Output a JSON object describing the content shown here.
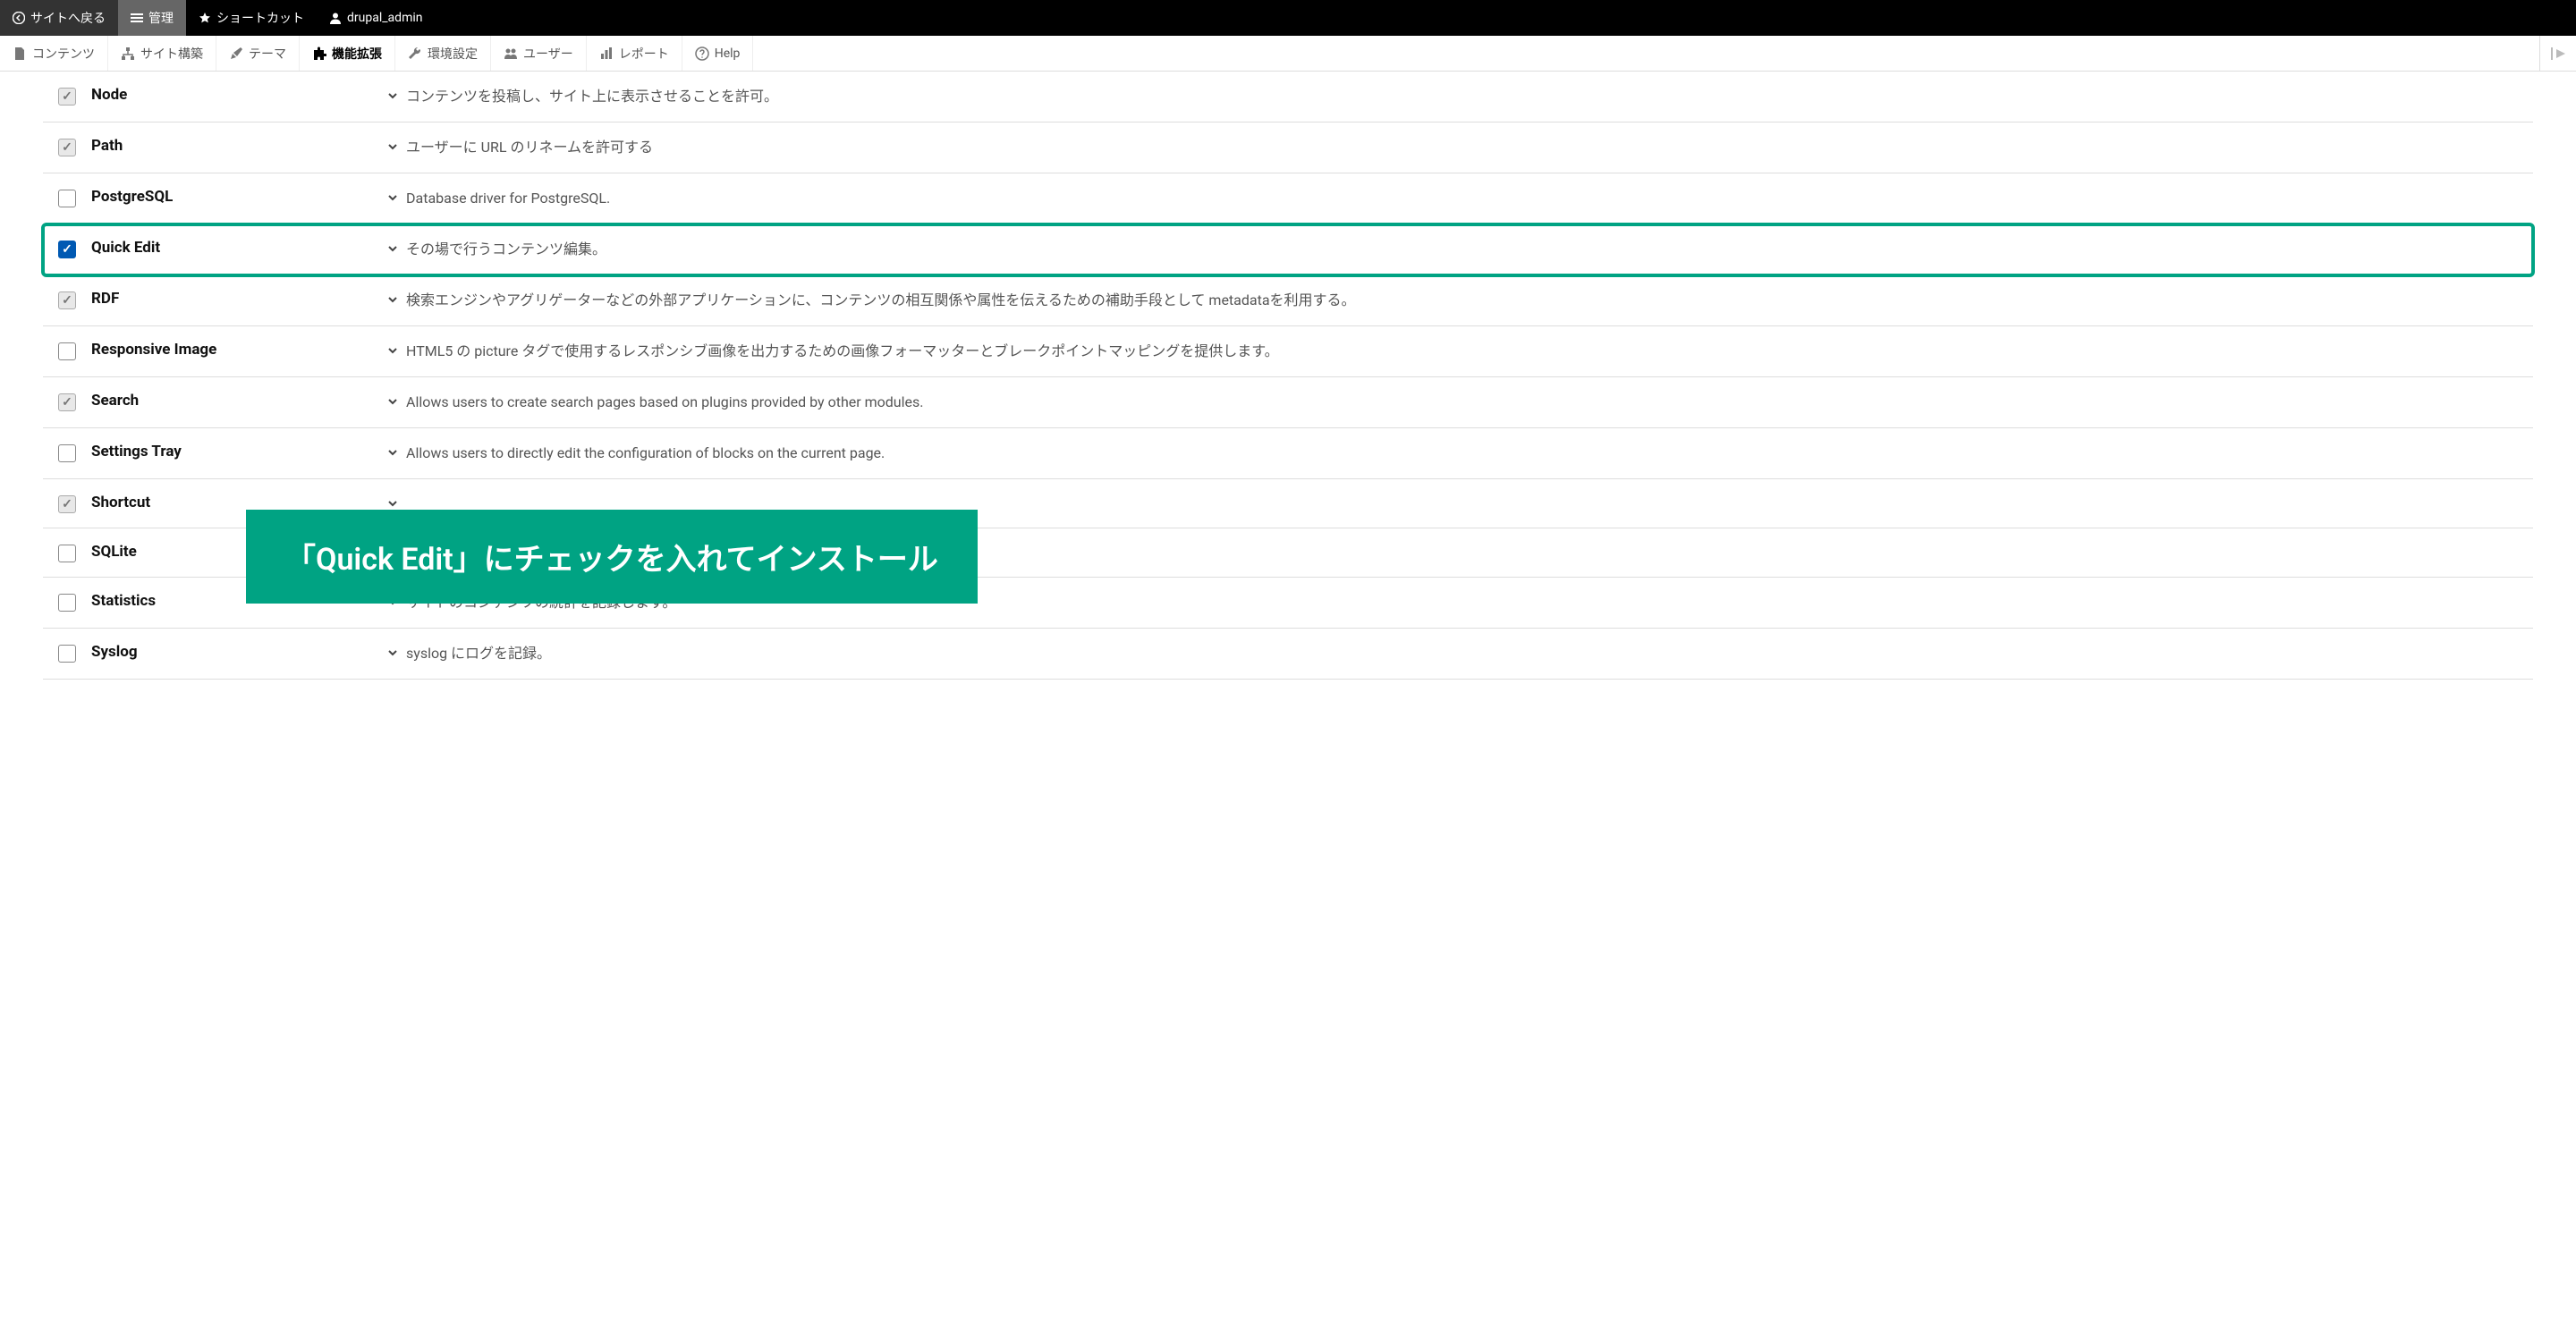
{
  "topbar": {
    "back": "サイトへ戻る",
    "admin": "管理",
    "shortcuts": "ショートカット",
    "user": "drupal_admin"
  },
  "secondbar": {
    "content": "コンテンツ",
    "structure": "サイト構築",
    "appearance": "テーマ",
    "extend": "機能拡張",
    "configuration": "環境設定",
    "people": "ユーザー",
    "reports": "レポート",
    "help": "Help"
  },
  "modules": [
    {
      "name": "Node",
      "desc": "コンテンツを投稿し、サイト上に表示させることを許可。",
      "checked": true,
      "disabled": true,
      "highlight": false
    },
    {
      "name": "Path",
      "desc": "ユーザーに URL のリネームを許可する",
      "checked": true,
      "disabled": true,
      "highlight": false
    },
    {
      "name": "PostgreSQL",
      "desc": "Database driver for PostgreSQL.",
      "checked": false,
      "disabled": false,
      "highlight": false
    },
    {
      "name": "Quick Edit",
      "desc": "その場で行うコンテンツ編集。",
      "checked": true,
      "disabled": false,
      "highlight": true
    },
    {
      "name": "RDF",
      "desc": "検索エンジンやアグリゲーターなどの外部アプリケーションに、コンテンツの相互関係や属性を伝えるための補助手段として metadataを利用する。",
      "checked": true,
      "disabled": true,
      "highlight": false
    },
    {
      "name": "Responsive Image",
      "desc": "HTML5 の picture タグで使用するレスポンシブ画像を出力するための画像フォーマッターとブレークポイントマッピングを提供します。",
      "checked": false,
      "disabled": false,
      "highlight": false
    },
    {
      "name": "Search",
      "desc": "Allows users to create search pages based on plugins provided by other modules.",
      "checked": true,
      "disabled": true,
      "highlight": false
    },
    {
      "name": "Settings Tray",
      "desc": "Allows users to directly edit the configuration of blocks on the current page.",
      "checked": false,
      "disabled": false,
      "highlight": false
    },
    {
      "name": "Shortcut",
      "desc": "",
      "checked": true,
      "disabled": true,
      "highlight": false
    },
    {
      "name": "SQLite",
      "desc": "",
      "checked": false,
      "disabled": false,
      "highlight": false
    },
    {
      "name": "Statistics",
      "desc": "サイトのコンテンツの統計を記録します。",
      "checked": false,
      "disabled": false,
      "highlight": false
    },
    {
      "name": "Syslog",
      "desc": "syslog にログを記録。",
      "checked": false,
      "disabled": false,
      "highlight": false
    }
  ],
  "callout": "「Quick Edit」にチェックを入れてインストール"
}
